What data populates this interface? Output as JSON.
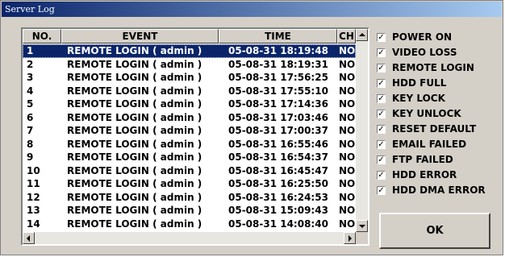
{
  "window": {
    "title": "Server Log"
  },
  "columns": [
    "NO.",
    "EVENT",
    "TIME",
    "CH"
  ],
  "rows": [
    {
      "no": "1",
      "event": "REMOTE LOGIN ( admin )",
      "time": "05-08-31 18:19:48",
      "ch": "NO",
      "selected": true
    },
    {
      "no": "2",
      "event": "REMOTE LOGIN ( admin )",
      "time": "05-08-31 18:19:31",
      "ch": "NO"
    },
    {
      "no": "3",
      "event": "REMOTE LOGIN ( admin )",
      "time": "05-08-31 17:56:25",
      "ch": "NO"
    },
    {
      "no": "4",
      "event": "REMOTE LOGIN ( admin )",
      "time": "05-08-31 17:55:10",
      "ch": "NO"
    },
    {
      "no": "5",
      "event": "REMOTE LOGIN ( admin )",
      "time": "05-08-31 17:14:36",
      "ch": "NO"
    },
    {
      "no": "6",
      "event": "REMOTE LOGIN ( admin )",
      "time": "05-08-31 17:03:46",
      "ch": "NO"
    },
    {
      "no": "7",
      "event": "REMOTE LOGIN ( admin )",
      "time": "05-08-31 17:00:37",
      "ch": "NO"
    },
    {
      "no": "8",
      "event": "REMOTE LOGIN ( admin )",
      "time": "05-08-31 16:55:46",
      "ch": "NO"
    },
    {
      "no": "9",
      "event": "REMOTE LOGIN ( admin )",
      "time": "05-08-31 16:54:37",
      "ch": "NO"
    },
    {
      "no": "10",
      "event": "REMOTE LOGIN ( admin )",
      "time": "05-08-31 16:45:47",
      "ch": "NO"
    },
    {
      "no": "11",
      "event": "REMOTE LOGIN ( admin )",
      "time": "05-08-31 16:25:50",
      "ch": "NO"
    },
    {
      "no": "12",
      "event": "REMOTE LOGIN ( admin )",
      "time": "05-08-31 16:24:53",
      "ch": "NO"
    },
    {
      "no": "13",
      "event": "REMOTE LOGIN ( admin )",
      "time": "05-08-31 15:09:43",
      "ch": "NO"
    },
    {
      "no": "14",
      "event": "REMOTE LOGIN ( admin )",
      "time": "05-08-31 14:08:40",
      "ch": "NO"
    }
  ],
  "filters": [
    {
      "label": "POWER ON",
      "checked": true
    },
    {
      "label": "VIDEO LOSS",
      "checked": true
    },
    {
      "label": "REMOTE LOGIN",
      "checked": true
    },
    {
      "label": "HDD FULL",
      "checked": true
    },
    {
      "label": "KEY LOCK",
      "checked": true
    },
    {
      "label": "KEY UNLOCK",
      "checked": true
    },
    {
      "label": "RESET DEFAULT",
      "checked": true
    },
    {
      "label": "EMAIL FAILED",
      "checked": true
    },
    {
      "label": "FTP FAILED",
      "checked": true
    },
    {
      "label": "HDD ERROR",
      "checked": true
    },
    {
      "label": "HDD DMA ERROR",
      "checked": true
    }
  ],
  "check_mark": "✓",
  "ok_label": "OK",
  "colors": {
    "titlebar": "#0a246a",
    "selection": "#0a246a",
    "face": "#d4d0c8"
  }
}
